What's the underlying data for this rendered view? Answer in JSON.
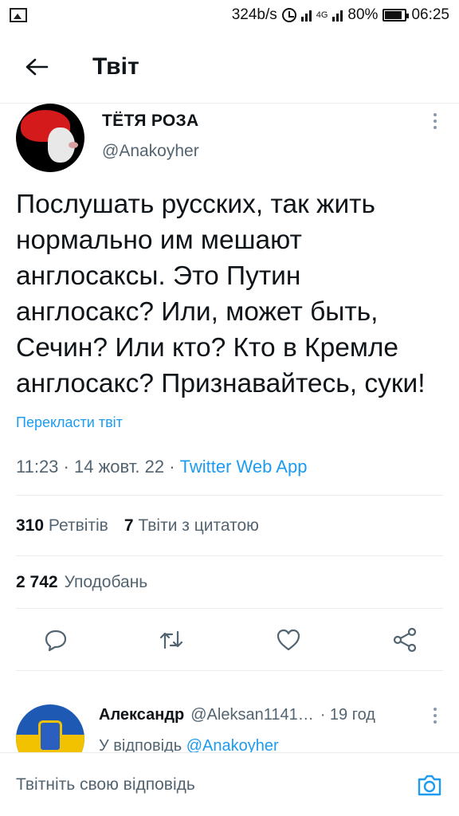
{
  "status_bar": {
    "net_speed": "324b/s",
    "network": "4G",
    "battery": "80%",
    "battery_level": 0.8,
    "time": "06:25"
  },
  "header": {
    "title": "Твіт"
  },
  "tweet": {
    "author_name": "ТЁТЯ РОЗА",
    "author_handle": "@Anakoyher",
    "text": "Послушать русских, так жить нормально им мешают англосаксы. Это Путин англосакс? Или, может быть, Сечин? Или кто? Кто в Кремле англосакс? Признавайтесь, суки!",
    "translate_label": "Перекласти твіт",
    "time": "11:23",
    "date": "14 жовт. 22",
    "separator": "·",
    "source": "Twitter Web App",
    "retweets_count": "310",
    "retweets_label": "Ретвітів",
    "quotes_count": "7",
    "quotes_label": "Твіти з цитатою",
    "likes_count": "2 742",
    "likes_label": "Уподобань"
  },
  "reply": {
    "author_name": "Александр",
    "author_handle": "@Aleksan1141…",
    "time": "· 19 год",
    "reply_to_prefix": "У відповідь",
    "reply_to_handle": "@Anakoyher"
  },
  "composer": {
    "placeholder": "Твітніть свою відповідь"
  },
  "colors": {
    "accent": "#1d9bf0",
    "text": "#0f1419",
    "secondary": "#536471",
    "border": "#e6ecf0"
  },
  "icons": [
    "image-icon",
    "alarm-icon",
    "signal-icon",
    "battery-icon",
    "back-arrow-icon",
    "more-icon",
    "reply-icon",
    "retweet-icon",
    "like-icon",
    "share-icon",
    "camera-icon"
  ]
}
